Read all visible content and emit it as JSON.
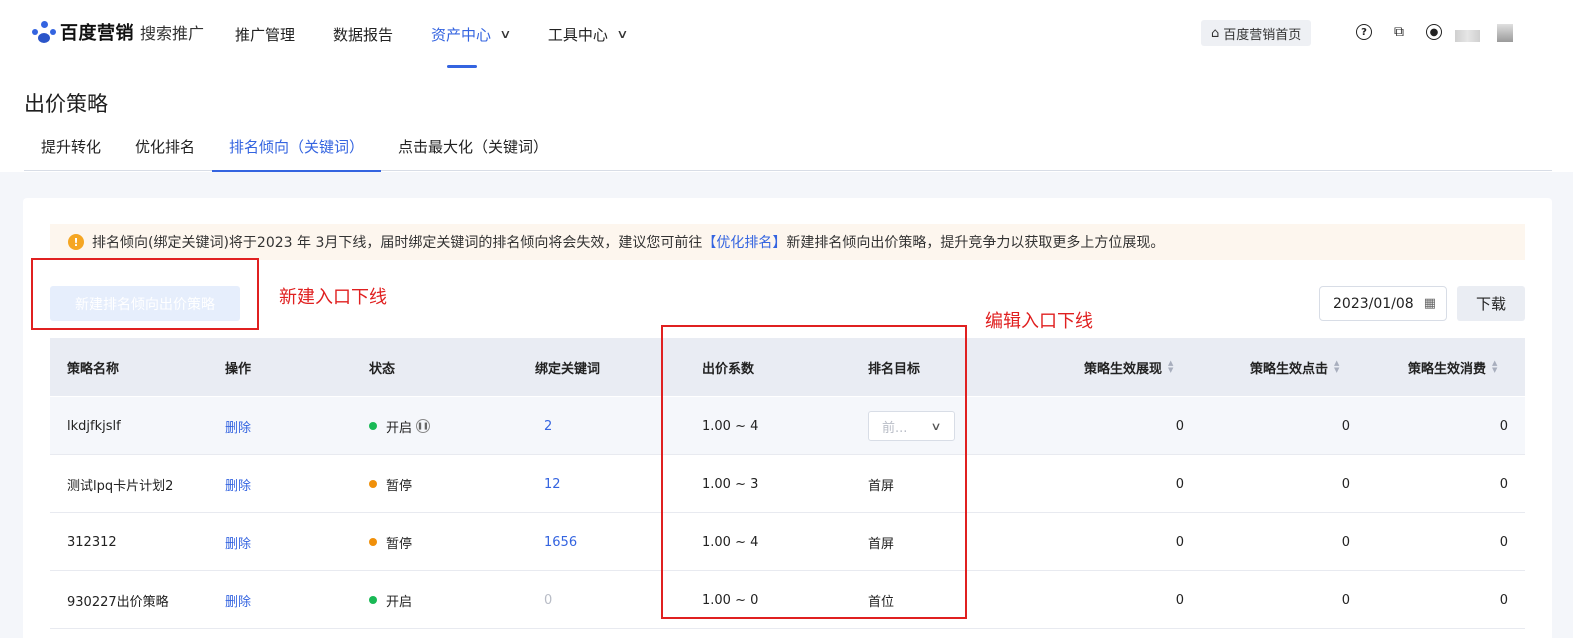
{
  "topbar": {
    "logo_brand": "百度营销",
    "logo_product": "搜索推广",
    "nav": [
      {
        "label": "推广管理",
        "active": false,
        "dropdown": false
      },
      {
        "label": "数据报告",
        "active": false,
        "dropdown": false
      },
      {
        "label": "资产中心",
        "active": true,
        "dropdown": true
      },
      {
        "label": "工具中心",
        "active": false,
        "dropdown": true
      }
    ],
    "home_button": "百度营销首页",
    "icons": [
      "help-icon",
      "copy-icon",
      "user-icon"
    ]
  },
  "page": {
    "title": "出价策略",
    "tabs": [
      "提升转化",
      "优化排名",
      "排名倾向（关键词）",
      "点击最大化（关键词）"
    ],
    "active_tab": 2
  },
  "notice": {
    "text_before": "排名倾向(绑定关键词)将于2023 年 3月下线，届时绑定关键词的排名倾向将会失效，建议您可前往",
    "link": "【优化排名】",
    "text_after": "新建排名倾向出价策略，提升竞争力以获取更多上方位展现。"
  },
  "toolbar": {
    "new_strategy_button": "新建排名倾向出价策略",
    "date": "2023/01/08",
    "download_button": "下载"
  },
  "annotations": {
    "new_entry_offline": "新建入口下线",
    "edit_entry_offline": "编辑入口下线"
  },
  "table": {
    "columns": [
      "策略名称",
      "操作",
      "状态",
      "绑定关键词",
      "出价系数",
      "排名目标",
      "策略生效展现",
      "策略生效点击",
      "策略生效消费"
    ],
    "rows": [
      {
        "name": "lkdjfkjslf",
        "action": "删除",
        "status": "开启",
        "status_color": "#19b955",
        "keywords": "2",
        "keywords_muted": false,
        "coef": "1.00 ~ 4",
        "target": "前...",
        "target_is_select": true,
        "impressions": "0",
        "clicks": "0",
        "cost": "0"
      },
      {
        "name": "测试lpq卡片计划2",
        "action": "删除",
        "status": "暂停",
        "status_color": "#f0900a",
        "keywords": "12",
        "keywords_muted": false,
        "coef": "1.00 ~ 3",
        "target": "首屏",
        "target_is_select": false,
        "impressions": "0",
        "clicks": "0",
        "cost": "0"
      },
      {
        "name": "312312",
        "action": "删除",
        "status": "暂停",
        "status_color": "#f0900a",
        "keywords": "1656",
        "keywords_muted": false,
        "coef": "1.00 ~ 4",
        "target": "首屏",
        "target_is_select": false,
        "impressions": "0",
        "clicks": "0",
        "cost": "0"
      },
      {
        "name": "930227出价策略",
        "action": "删除",
        "status": "开启",
        "status_color": "#19b955",
        "keywords": "0",
        "keywords_muted": true,
        "coef": "1.00 ~ 0",
        "target": "首位",
        "target_is_select": false,
        "impressions": "0",
        "clicks": "0",
        "cost": "0"
      }
    ]
  },
  "colors": {
    "accent": "#3464e0",
    "annotation_red": "#e02020",
    "notice_bg": "#fdf6ee"
  }
}
